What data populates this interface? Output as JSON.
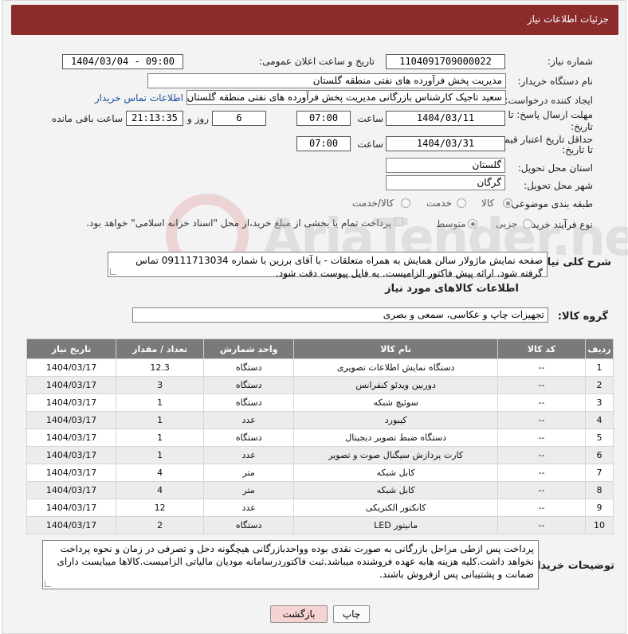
{
  "header": {
    "title": "جزئیات اطلاعات نیاز"
  },
  "form": {
    "need_number_label": "شماره نیاز:",
    "need_number": "1104091709000022",
    "announce_label": "تاریخ و ساعت اعلان عمومی:",
    "announce_value": "1404/03/04 - 09:00",
    "buyer_org_label": "نام دستگاه خریدار:",
    "buyer_org": "مدیریت پخش فرآورده های نفتی منطقه گلستان",
    "requester_label": "ایجاد کننده درخواست:",
    "requester": "سعید تاجیک کارشناس بازرگانی مدیریت پخش فرآورده های نفتی منطقه گلستان",
    "contact_link": "اطلاعات تماس خریدار",
    "reply_deadline_label_1": "مهلت ارسال پاسخ: تا",
    "reply_deadline_label_2": "تاریخ:",
    "reply_date": "1404/03/11",
    "time_label": "ساعت",
    "reply_time": "07:00",
    "days_value": "6",
    "days_label": "روز و",
    "remaining_time": "21:13:35",
    "remaining_label": "ساعت باقی مانده",
    "price_valid_label_1": "حداقل تاریخ اعتبار قیمت:",
    "price_valid_label_2": "تا تاریخ:",
    "price_valid_date": "1404/03/31",
    "price_valid_time": "07:00",
    "province_label": "استان محل تحویل:",
    "province": "گلستان",
    "city_label": "شهر محل تحویل:",
    "city": "گرگان",
    "category_label": "طبقه بندی موضوعی:",
    "category_options": [
      "کالا",
      "خدمت",
      "کالا/خدمت"
    ],
    "category_selected": "کالا",
    "process_label": "نوع فرآیند خرید :",
    "process_options": [
      "جزیی",
      "متوسط"
    ],
    "process_selected": "متوسط",
    "payment_note": "پرداخت تمام یا بخشی از مبلغ خرید،از محل \"اسناد خزانه اسلامی\" خواهد بود."
  },
  "description": {
    "label": "شرح کلی نیاز:",
    "text": "صفحه نمایش ماژولار سالن همایش به همراه متعلقات - با آقای برزین با شماره 09111713034 تماس گرفته شود. ارائه پیش فاکتور الزامیست. به فایل پیوست دقت شود."
  },
  "goods": {
    "section_title": "اطلاعات کالاهای مورد نیاز",
    "group_label": "گروه کالا:",
    "group_value": "تجهیزات چاپ و عکاسی، سمعی و بصری",
    "columns": [
      "ردیف",
      "کد کالا",
      "نام کالا",
      "واحد شمارش",
      "تعداد / مقدار",
      "تاریخ نیاز"
    ],
    "rows": [
      [
        "1",
        "--",
        "دستگاه نمایش اطلاعات تصویری",
        "دستگاه",
        "12.3",
        "1404/03/17"
      ],
      [
        "2",
        "--",
        "دوربین ویدئو کنفرانس",
        "دستگاه",
        "3",
        "1404/03/17"
      ],
      [
        "3",
        "--",
        "سوئیچ شبکه",
        "دستگاه",
        "1",
        "1404/03/17"
      ],
      [
        "4",
        "--",
        "کیبورد",
        "عدد",
        "1",
        "1404/03/17"
      ],
      [
        "5",
        "--",
        "دستگاه ضبط تصویر دیجیتال",
        "دستگاه",
        "1",
        "1404/03/17"
      ],
      [
        "6",
        "--",
        "کارت پردازش سیگنال صوت و تصویر",
        "عدد",
        "1",
        "1404/03/17"
      ],
      [
        "7",
        "--",
        "کابل شبکه",
        "متر",
        "4",
        "1404/03/17"
      ],
      [
        "8",
        "--",
        "کابل شبکه",
        "متر",
        "4",
        "1404/03/17"
      ],
      [
        "9",
        "--",
        "کانکتور الکتریکی",
        "عدد",
        "12",
        "1404/03/17"
      ],
      [
        "10",
        "--",
        "مانیتور LED",
        "دستگاه",
        "2",
        "1404/03/17"
      ]
    ]
  },
  "buyer_notes": {
    "label": "توضیحات خریدار:",
    "text": "پرداخت پس ازطی مراحل بازرگانی به صورت نقدی بوده وواحدبازرگانی هیچگونه دخل و تصرفی در زمان و نحوه پرداخت نخواهد داشت.کلیه هزینه هابه عهده فروشنده میباشد.ثبت فاکتوردرسامانه مودیان مالیاتی الزامیست.کالاها میبایست دارای ضمانت و پشتیبانی پس ازفروش باشند."
  },
  "buttons": {
    "print": "چاپ",
    "back": "بازگشت"
  },
  "colors": {
    "header": "#8b2b2b",
    "table_header": "#7a7a7a",
    "back_button": "#f6d3d3"
  }
}
